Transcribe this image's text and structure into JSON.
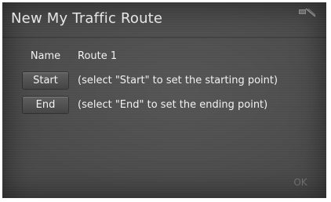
{
  "title": "New My Traffic Route",
  "status_icon": "signal-icon",
  "rows": [
    {
      "label": "Name",
      "value": "Route 1"
    },
    {
      "label": "Start",
      "value": "(select \"Start\" to set the starting point)"
    },
    {
      "label": "End",
      "value": "(select \"End\" to set the ending point)"
    }
  ],
  "ok_label": "OK"
}
